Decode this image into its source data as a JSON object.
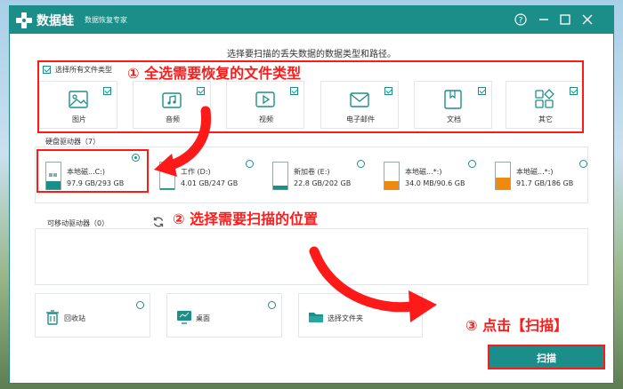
{
  "app": {
    "name": "数据蛙",
    "subtitle": "数据恢复专家",
    "accent": "#1c8e8a"
  },
  "window_controls": [
    "help-icon",
    "minimize-icon",
    "maximize-icon",
    "close-icon"
  ],
  "instruction": "选择要扫描的丢失数据的数据类型和路径。",
  "select_all_label": "选择所有文件类型",
  "file_types": [
    {
      "label": "图片",
      "icon": "image-icon",
      "checked": true
    },
    {
      "label": "音频",
      "icon": "music-icon",
      "checked": true
    },
    {
      "label": "视频",
      "icon": "video-icon",
      "checked": true
    },
    {
      "label": "电子邮件",
      "icon": "email-icon",
      "checked": true
    },
    {
      "label": "文档",
      "icon": "document-icon",
      "checked": true
    },
    {
      "label": "其它",
      "icon": "other-icon",
      "checked": true
    }
  ],
  "disk_section": {
    "title": "硬盘驱动器（7）",
    "drives": [
      {
        "name": "本地磁...C:)",
        "size": "97.9 GB/293 GB",
        "selected": true,
        "icon": "windows-drive-icon"
      },
      {
        "name": "工作 (D:)",
        "size": "4.01 GB/247 GB",
        "selected": false,
        "icon": "drive-icon"
      },
      {
        "name": "新加卷 (E:)",
        "size": "22.8 GB/202 GB",
        "selected": false,
        "icon": "drive-icon"
      },
      {
        "name": "本地磁...*:)",
        "size": "34.0 MB/90.6 GB",
        "selected": false,
        "icon": "drive-orange-icon"
      },
      {
        "name": "本地磁...*:)",
        "size": "91.7 GB/186 GB",
        "selected": false,
        "icon": "drive-orange-icon"
      }
    ]
  },
  "removable_section": {
    "title": "可移动驱动器（0）"
  },
  "locations": [
    {
      "label": "回收站",
      "icon": "recycle-bin-icon"
    },
    {
      "label": "桌面",
      "icon": "desktop-icon"
    },
    {
      "label": "选择文件夹",
      "icon": "folder-icon"
    }
  ],
  "scan_button": "扫描",
  "annotations": {
    "step1": "① 全选需要恢复的文件类型",
    "step2": "② 选择需要扫描的位置",
    "step3": "③ 点击【扫描】"
  }
}
